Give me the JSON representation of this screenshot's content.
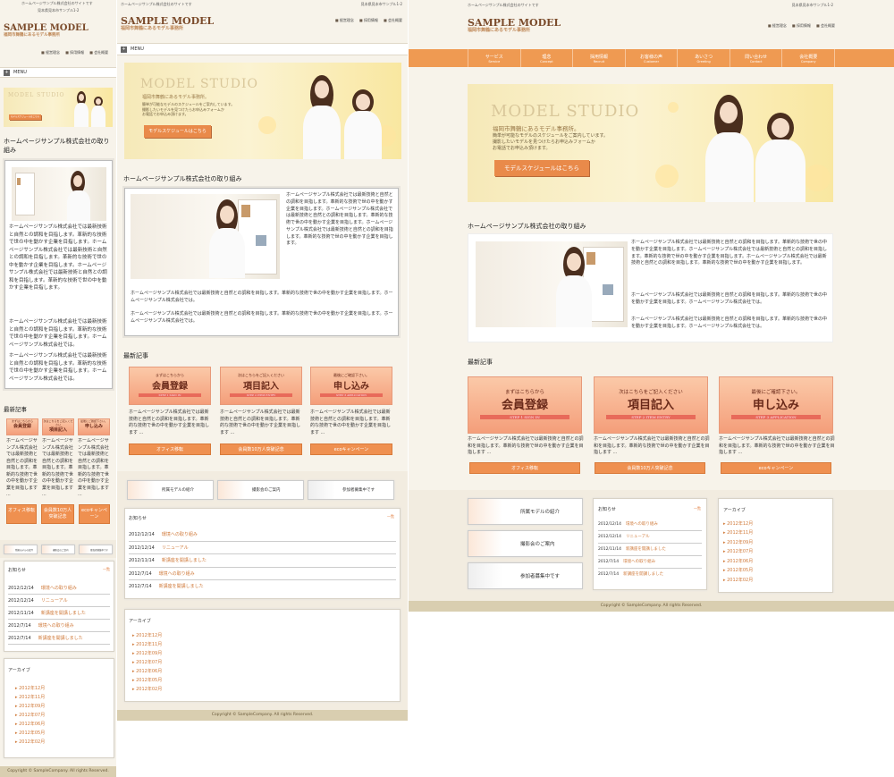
{
  "site": {
    "top_left": "ホームページサンプル株式会社のサイトです",
    "top_right": "見本県見本市サンプル1-2",
    "logo_main": "SAMPLE MODEL",
    "logo_sub": "福岡市舞鶴にあるモデル事務所",
    "header_links": [
      "経営理念",
      "採用情報",
      "会社概要"
    ],
    "menu_label": "MENU",
    "menu_icon_glyph": "+"
  },
  "nav": [
    {
      "jp": "サービス",
      "en": "Service"
    },
    {
      "jp": "理念",
      "en": "Concept"
    },
    {
      "jp": "採用情報",
      "en": "Recruit"
    },
    {
      "jp": "お客様の声",
      "en": "Customer"
    },
    {
      "jp": "あいさつ",
      "en": "Greeting"
    },
    {
      "jp": "問い合わせ",
      "en": "Contact"
    },
    {
      "jp": "会社概要",
      "en": "Company"
    }
  ],
  "hero": {
    "title": "MODEL STUDIO",
    "subtitle": "福岡市舞鶴にあるモデル事務所。",
    "desc1": "everyday model schedules introduction",
    "desc_lines": [
      "簡単が可能なモデルのスケジュールをご案内しています。",
      "撮影したいモデルを見つけたらお申込みフォームか",
      "お電話でお申込み頂けます。"
    ],
    "cta": "モデルスケジュールはこちら"
  },
  "feature": {
    "title": "ホームページサンプル株式会社の取り組み",
    "para1": "ホームページサンプル株式会社では最新技術と自然との調和を目指します。革新的な技術で世の中を動かす企業を目指します。ホームページサンプル株式会社では最新技術と自然との調和を目指します。革新的な技術で世の中を動かす企業を目指します。ホームページサンプル株式会社では最新技術と自然との調和を目指します。革新的な技術で世の中を動かす企業を目指します。",
    "para2": "ホームページサンプル株式会社では最新技術と自然との調和を目指します。革新的な技術で世の中を動かす企業を目指します。ホームページサンプル株式会社では。",
    "para3": "ホームページサンプル株式会社では最新技術と自然との調和を目指します。革新的な技術で世の中を動かす企業を目指します。ホームページサンプル株式会社では。"
  },
  "latest": {
    "title": "最新記事",
    "cards": [
      {
        "top": "まずはこちらから",
        "main": "会員登録",
        "step": "STEP 1 SIGN IN",
        "desc": "ホームページサンプル株式会社では最新技術と自然との調和を目指します。革新的な技術で世の中を動かす企業を目指します ...",
        "button": "オフィス移転"
      },
      {
        "top": "次はこちらをご記入ください",
        "main": "項目記入",
        "step": "STEP 2 ITEM ENTRY",
        "desc": "ホームページサンプル株式会社では最新技術と自然との調和を目指します。革新的な技術で世の中を動かす企業を目指します ...",
        "button": "会員数10万人突破記念"
      },
      {
        "top": "最後にご確認下さい。",
        "main": "申し込み",
        "step": "STEP 3 APPLICATION",
        "desc": "ホームページサンプル株式会社では最新技術と自然との調和を目指します。革新的な技術で世の中を動かす企業を目指します ...",
        "button": "ecoキャンペーン"
      }
    ]
  },
  "banners": [
    "所属モデルの紹介",
    "撮影会のご案内",
    "参加者募集中です"
  ],
  "news": {
    "title": "お知らせ",
    "more": "一覧",
    "items": [
      {
        "date": "2012/12/14",
        "text": "環境への取り組み"
      },
      {
        "date": "2012/12/14",
        "text": "リニューアル"
      },
      {
        "date": "2012/11/14",
        "text": "新講座を開講しました"
      },
      {
        "date": "2012/7/14",
        "text": "環境への取り組み"
      },
      {
        "date": "2012/7/14",
        "text": "新講座を開講しました"
      }
    ]
  },
  "archive": {
    "title": "アーカイブ",
    "items": [
      "2012年12月",
      "2012年11月",
      "2012年09月",
      "2012年07月",
      "2012年06月",
      "2012年05月",
      "2012年02月"
    ]
  },
  "footer": "Copyright © SampleCompany. All rights Reserved.",
  "colors": {
    "accent": "#ef9a52",
    "bg": "#f7f3ea",
    "footer": "#d9ceb0",
    "link": "#d07a3a"
  }
}
